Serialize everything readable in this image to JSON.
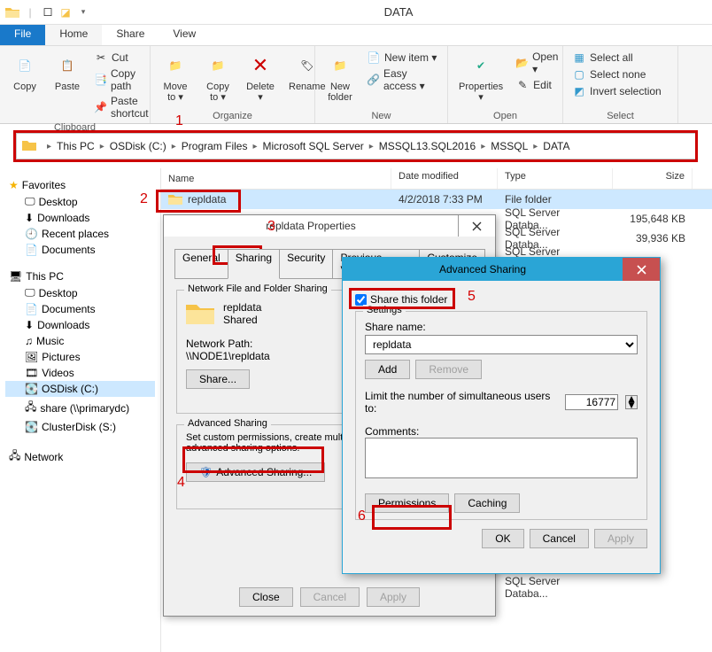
{
  "window": {
    "title": "DATA"
  },
  "tabs": {
    "file": "File",
    "home": "Home",
    "share": "Share",
    "view": "View"
  },
  "ribbon": {
    "clipboard": {
      "label": "Clipboard",
      "copy": "Copy",
      "paste": "Paste",
      "cut": "Cut",
      "copypath": "Copy path",
      "pasteshortcut": "Paste shortcut"
    },
    "organize": {
      "label": "Organize",
      "moveto": "Move\nto ▾",
      "copyto": "Copy\nto ▾",
      "delete": "Delete\n▾",
      "rename": "Rename"
    },
    "new": {
      "label": "New",
      "newfolder": "New\nfolder",
      "newitem": "New item ▾",
      "easyaccess": "Easy access ▾"
    },
    "open": {
      "label": "Open",
      "properties": "Properties\n▾",
      "open": "Open ▾",
      "edit": "Edit"
    },
    "select": {
      "label": "Select",
      "all": "Select all",
      "none": "Select none",
      "invert": "Invert selection"
    }
  },
  "breadcrumb": [
    "This PC",
    "OSDisk (C:)",
    "Program Files",
    "Microsoft SQL Server",
    "MSSQL13.SQL2016",
    "MSSQL",
    "DATA"
  ],
  "columns": {
    "name": "Name",
    "date": "Date modified",
    "type": "Type",
    "size": "Size"
  },
  "rows": [
    {
      "name": "repldata",
      "date": "4/2/2018 7:33 PM",
      "type": "File folder",
      "size": ""
    },
    {
      "name": "",
      "date": "",
      "type": "SQL Server Databa...",
      "size": "195,648 KB"
    },
    {
      "name": "",
      "date": "",
      "type": "SQL Server Databa...",
      "size": "39,936 KB"
    },
    {
      "name": "",
      "date": "",
      "type": "SQL Server Databa...",
      "size": ""
    },
    {
      "name": "",
      "date": "",
      "type": "SQL Server Databa...",
      "size": ""
    },
    {
      "name": "",
      "date": "",
      "type": "SQL Server Databa...",
      "size": ""
    }
  ],
  "sidebar": {
    "favorites": {
      "label": "Favorites",
      "items": [
        "Desktop",
        "Downloads",
        "Recent places",
        "Documents"
      ]
    },
    "thispc": {
      "label": "This PC",
      "items": [
        "Desktop",
        "Documents",
        "Downloads",
        "Music",
        "Pictures",
        "Videos",
        "OSDisk (C:)",
        "share (\\\\primarydc)",
        "ClusterDisk (S:)"
      ]
    },
    "network": {
      "label": "Network"
    }
  },
  "steps": {
    "s1": "1",
    "s2": "2",
    "s3": "3",
    "s4": "4",
    "s5": "5",
    "s6": "6"
  },
  "dlg1": {
    "title": "repldata Properties",
    "tabs": [
      "General",
      "Sharing",
      "Security",
      "Previous Versions",
      "Customize"
    ],
    "nfs": {
      "title": "Network File and Folder Sharing",
      "name": "repldata",
      "status": "Shared",
      "pathlabel": "Network Path:",
      "path": "\\\\NODE1\\repldata",
      "sharebtn": "Share..."
    },
    "adv": {
      "title": "Advanced Sharing",
      "desc": "Set custom permissions, create multiple shares, and set other advanced sharing options.",
      "btn": "Advanced Sharing..."
    },
    "buttons": {
      "close": "Close",
      "cancel": "Cancel",
      "apply": "Apply"
    }
  },
  "dlg2": {
    "title": "Advanced Sharing",
    "check": "Share this folder",
    "group": "Settings",
    "sharename_label": "Share name:",
    "sharename": "repldata",
    "add": "Add",
    "remove": "Remove",
    "limit_label": "Limit the number of simultaneous users to:",
    "limit": "16777",
    "comments_label": "Comments:",
    "permissions": "Permissions",
    "caching": "Caching",
    "ok": "OK",
    "cancel": "Cancel",
    "apply": "Apply"
  }
}
